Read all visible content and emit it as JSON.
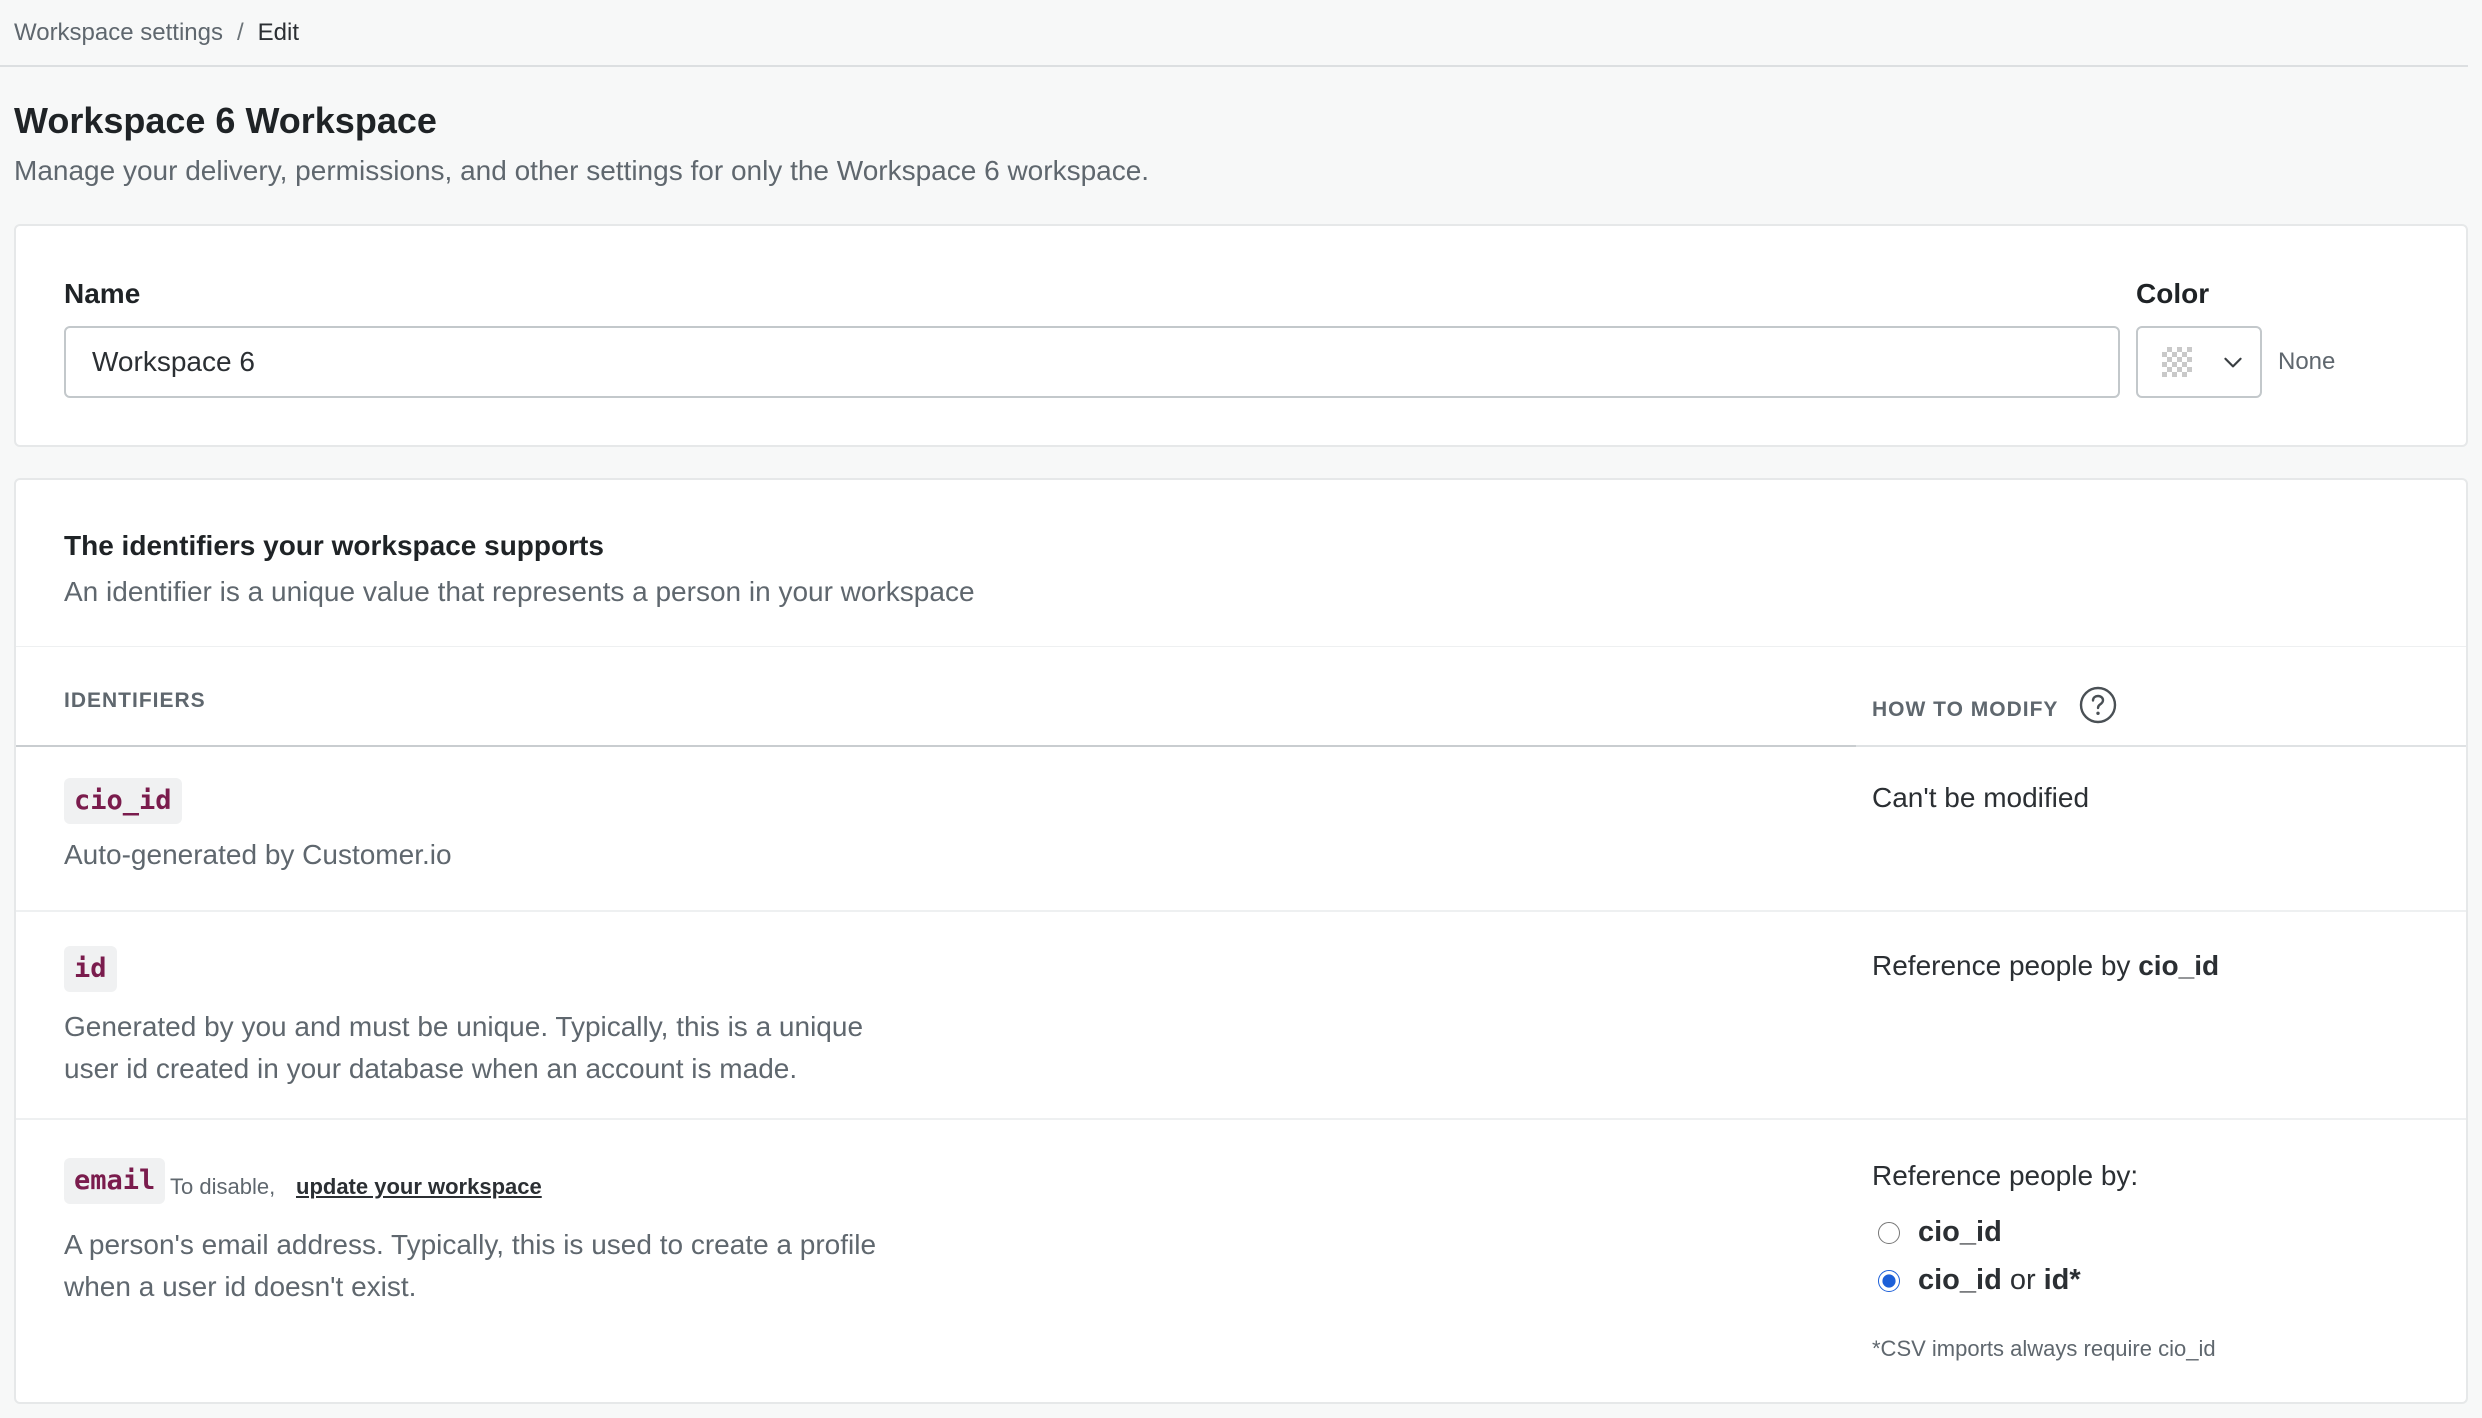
{
  "breadcrumb": {
    "parent": "Workspace settings",
    "separator": "/",
    "current": "Edit"
  },
  "page": {
    "title": "Workspace 6 Workspace",
    "subtitle": "Manage your delivery, permissions, and other settings for only the Workspace 6 workspace."
  },
  "name_card": {
    "name_label": "Name",
    "name_value": "Workspace 6",
    "color_label": "Color",
    "color_value": "None"
  },
  "identifiers": {
    "title": "The identifiers your workspace supports",
    "subtitle": "An identifier is a unique value that represents a person in your workspace",
    "columns": {
      "identifiers": "IDENTIFIERS",
      "how_to_modify": "HOW TO MODIFY"
    },
    "rows": [
      {
        "code": "cio_id",
        "description": "Auto-generated by Customer.io",
        "modify": "Can't be modified"
      },
      {
        "code": "id",
        "description_line1": "Generated by you and must be unique. Typically, this is a unique",
        "description_line2": "user id created in your database when an account is made.",
        "modify_prefix": "Reference people by",
        "modify_bold": "cio_id"
      },
      {
        "code": "email",
        "disable_note": "To disable,",
        "disable_link": "update your workspace",
        "description_line1": "A person's email address. Typically, this is used to create a profile",
        "description_line2": "when a user id doesn't exist.",
        "reference_label": "Reference people by:",
        "options": [
          {
            "label": "cio_id",
            "selected": false
          },
          {
            "label_a": "cio_id",
            "label_or": "or",
            "label_b": "id*",
            "selected": true
          }
        ],
        "csv_note": "*CSV imports always require cio_id"
      }
    ]
  },
  "colors": {
    "accent": "#1c5fd8",
    "code_text": "#7a1c4d"
  }
}
